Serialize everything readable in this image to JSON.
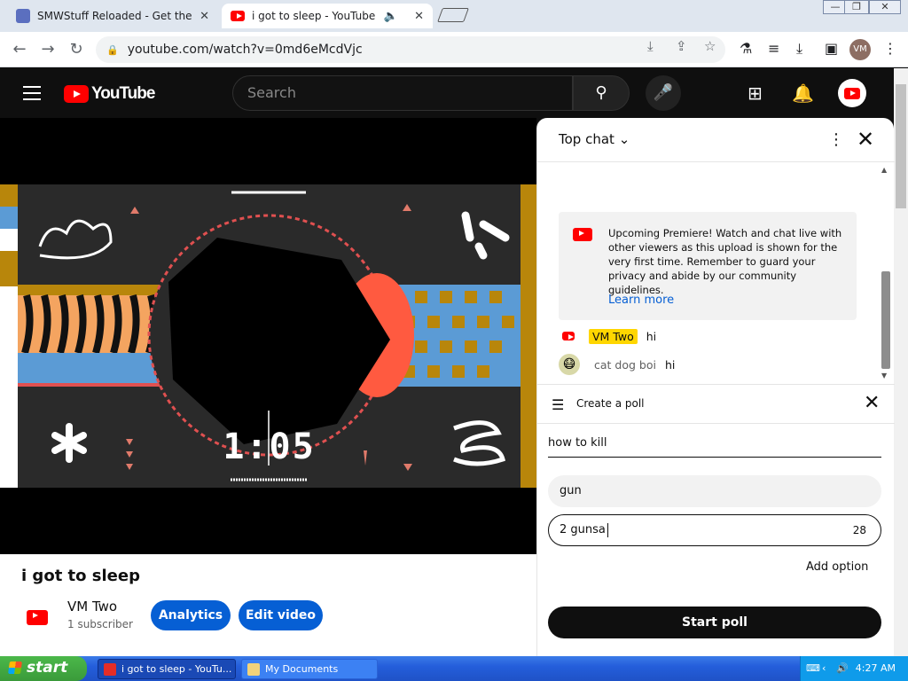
{
  "browser": {
    "tabs": [
      {
        "title": "SMWStuff Reloaded - Get the game",
        "active": false
      },
      {
        "title": "i got to sleep - YouTube",
        "active": true
      }
    ],
    "url": "youtube.com/watch?v=0md6eMcdVjc",
    "profile_initials": "VM"
  },
  "youtube": {
    "logo_text": "YouTube",
    "search_placeholder": "Search",
    "video": {
      "timer": "1:05",
      "title": "i got to sleep"
    },
    "channel": {
      "name": "VM Two",
      "subscribers": "1 subscriber"
    },
    "buttons": {
      "analytics": "Analytics",
      "edit_video": "Edit video"
    }
  },
  "chat": {
    "mode_label": "Top chat",
    "premiere_notice": "Upcoming Premiere! Watch and chat live with other viewers as this upload is shown for the very first time. Remember to guard your privacy and abide by our community guidelines.",
    "learn_more": "Learn more",
    "messages": [
      {
        "author": "VM Two",
        "text": "hi",
        "owner": true
      },
      {
        "author": "cat dog boi",
        "text": "hi",
        "owner": false
      }
    ]
  },
  "poll": {
    "title": "Create a poll",
    "question": "how to kill",
    "options": [
      {
        "text": "gun"
      },
      {
        "text": "2 gunsa",
        "remaining": "28"
      }
    ],
    "add_option": "Add option",
    "start_button": "Start poll"
  },
  "taskbar": {
    "start_label": "start",
    "tasks": [
      {
        "label": "i got to sleep - YouTu..."
      },
      {
        "label": "My Documents"
      }
    ],
    "clock": "4:27 AM"
  },
  "colors": {
    "youtube_red": "#ff0000",
    "link_blue": "#065fd4",
    "owner_badge": "#ffd600"
  }
}
